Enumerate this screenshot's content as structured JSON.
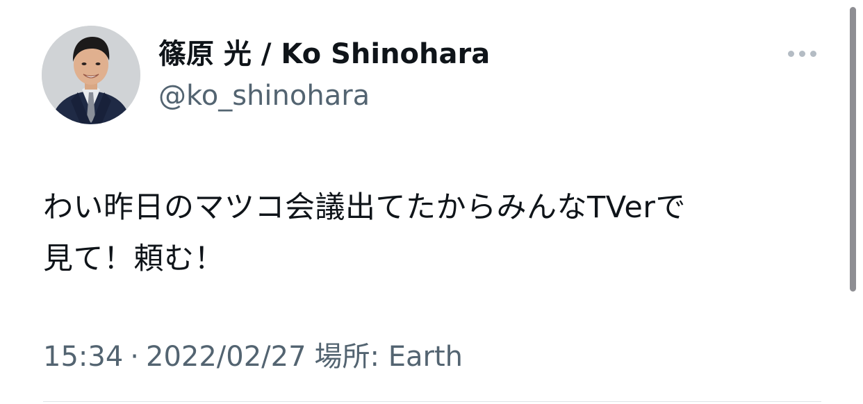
{
  "user": {
    "display_name": "篠原 光 / Ko Shinohara",
    "handle": "@ko_shinohara",
    "avatar_icon": "profile-photo-icon"
  },
  "tweet": {
    "line1": "わい昨日のマツコ会議出てたからみんなTVerで",
    "line2": "見て！頼む！"
  },
  "meta": {
    "time": "15:34",
    "separator": "·",
    "date": "2022/02/27",
    "location_label": "場所:",
    "location": "Earth"
  },
  "menu": {
    "icon": "more-options-icon"
  },
  "colors": {
    "text_primary": "#0f1419",
    "text_secondary": "#536471",
    "dots": "#b4bcc4",
    "divider": "#dfe3e6"
  }
}
